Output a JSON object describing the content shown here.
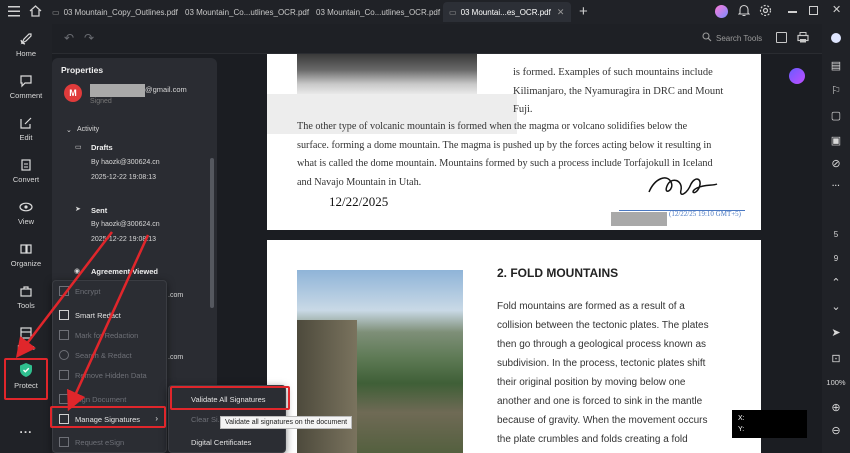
{
  "tabs": [
    {
      "label": "03 Mountain_Copy_Outlines.pdf"
    },
    {
      "label": "03 Mountain_Co...utlines_OCR.pdf"
    },
    {
      "label": "03 Mountain_Co...utlines_OCR.pdf"
    },
    {
      "label": "03 Mountai...es_OCR.pdf"
    }
  ],
  "toolbar": {
    "search_label": "Search Tools"
  },
  "left_rail": {
    "items": [
      {
        "label": "Home"
      },
      {
        "label": "Comment"
      },
      {
        "label": "Edit"
      },
      {
        "label": "Convert"
      },
      {
        "label": "View"
      },
      {
        "label": "Organize"
      },
      {
        "label": "Tools"
      },
      {
        "label": "Form"
      },
      {
        "label": "Protect"
      }
    ],
    "more": "..."
  },
  "properties": {
    "title": "Properties",
    "avatar_letter": "M",
    "email_suffix": "@gmail.com",
    "signed": "Signed",
    "activity_label": "Activity",
    "drafts": {
      "title": "Drafts",
      "by": "By haozk@300624.cn",
      "date": "2025-12-22 19:08:13"
    },
    "sent": {
      "title": "Sent",
      "by": "By haozk@300624.cn",
      "date": "2025-12-22 19:08:13"
    },
    "viewed": {
      "title": "Agreement Viewed"
    },
    "partial_com_1": ".com",
    "partial_com_2": ".com"
  },
  "protect_menu": {
    "items": [
      {
        "label": "Encrypt",
        "disabled": true
      },
      {
        "label": "Smart Redact",
        "disabled": false
      },
      {
        "label": "Mark for Redaction",
        "disabled": true
      },
      {
        "label": "Search & Redact",
        "disabled": true
      },
      {
        "label": "Remove Hidden Data",
        "disabled": true
      },
      {
        "label": "Sign Document",
        "disabled": true
      },
      {
        "label": "Manage Signatures",
        "disabled": false
      },
      {
        "label": "Request eSign",
        "disabled": true
      }
    ]
  },
  "signature_submenu": {
    "items": [
      {
        "label": "Validate All Signatures"
      },
      {
        "label": "Clear Si..."
      },
      {
        "label": "Digital Certificates"
      }
    ],
    "tooltip": "Validate all signatures on the document"
  },
  "document": {
    "page1_right_lines": [
      "is formed. Examples of such mountains include",
      "Kilimanjaro, the Nyamuragira in DRC and Mount",
      "Fuji."
    ],
    "page1_paragraph": [
      "The other type of volcanic mountain is formed when the magma or volcano solidifies below the",
      "surface. forming a dome mountain. The magma is pushed up by the forces acting below it resulting in",
      "what is called the dome mountain. Mountains formed by such a process include Torfajokull in Iceland",
      "and Navajo Mountain in Utah."
    ],
    "date_text": "12/22/2025",
    "signature_stamp": "(12/22/25 19:10 GMT+5)",
    "heading": "2. FOLD MOUNTAINS",
    "fold_lines": [
      "Fold mountains are formed as a result of a",
      "collision between the tectonic plates. The plates",
      "then go through a geological process known as",
      "subdivision. In the process, tectonic plates shift",
      "their original position by moving below one",
      "another and one is forced to sink in the mantle",
      "because of gravity. When the movement occurs",
      "the plate crumbles and folds creating a fold"
    ]
  },
  "coords": {
    "x_label": "X:",
    "y_label": "Y:"
  },
  "right_rail": {
    "page_number": "5",
    "page_total": "9",
    "zoom": "100%"
  },
  "colors": {
    "accent_red": "#e0262b",
    "protect_green": "#2fbf8f"
  }
}
